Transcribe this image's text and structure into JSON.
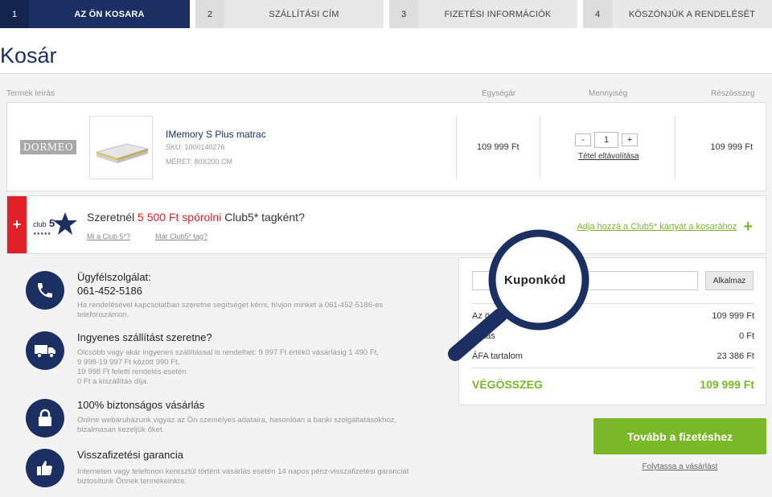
{
  "steps": [
    {
      "num": "1",
      "label": "AZ ÖN KOSARA"
    },
    {
      "num": "2",
      "label": "SZÁLLÍTÁSI CÍM"
    },
    {
      "num": "3",
      "label": "FIZETÉSI INFORMÁCIÓK"
    },
    {
      "num": "4",
      "label": "KÖSZÖNJÜK A RENDELÉSÉT"
    }
  ],
  "page_title": "Kosár",
  "columns": {
    "product": "Termék leírás",
    "unit_price": "Egységár",
    "quantity": "Mennyiség",
    "subtotal": "Részösszeg"
  },
  "item": {
    "brand": "DORMEO",
    "name": "IMemory S Plus matrac",
    "sku": "SKU: 1000140276",
    "size": "MÉRET:  80X200 CM",
    "unit_price": "109 999 Ft",
    "qty_minus": "-",
    "qty": "1",
    "qty_plus": "+",
    "remove": "Tétel eltávolítása",
    "subtotal": "109 999 Ft"
  },
  "club": {
    "plus": "+",
    "logo_text": "club",
    "logo_num": "5",
    "q_prefix": "Szeretnél ",
    "q_highlight": "5 500 Ft spórolni",
    "q_suffix": " Club5* tagként?",
    "link_what": "Mi a Club 5*?",
    "link_member": "Már Club5* tag?",
    "add_link": "Adja hozzá a Club5* kártyát a kosarához",
    "add_plus": "+"
  },
  "info": [
    {
      "heading": "Ügyfélszolgálat:",
      "phone": "061-452-5186",
      "text": [
        "Ha rendelésével kapcsolatban szeretne segítséget kérni, hívjon minket a 061-452-5186-es",
        "telefonszámon."
      ],
      "icon": "phone-icon"
    },
    {
      "heading": "Ingyenes szállítást szeretne?",
      "text": [
        "Olcsóbb vagy akár ingyenes szállítással is rendelhet: 9 997 Ft értékű vásárlásig 1 490 Ft,",
        "9 998-19 997 Ft között 990 Ft,",
        "19 998 Ft feletti rendelés esetén",
        "0 Ft a kiszállítás díja."
      ],
      "icon": "truck-icon"
    },
    {
      "heading": "100% biztonságos vásárlás",
      "text": [
        "Online webáruházunk vigyáz az Ön személyes adataira, hasonlóan a banki szolgáltatásokhoz,",
        "bizalmasan kezeljük őket."
      ],
      "icon": "lock-icon"
    },
    {
      "heading": "Visszafizetési garancia",
      "text": [
        "Interneten vagy telefonon keresztül történt vásárlás esetén 14 napos pénz-visszafizetési garanciát",
        "biztosítunk Önnek termékeinkre."
      ],
      "icon": "thumbs-up-icon"
    }
  ],
  "summary": {
    "coupon_label": "Kuponkód",
    "apply": "Alkalmaz",
    "rows": [
      {
        "label": "Az ö",
        "value": "109 999 Ft"
      },
      {
        "label": "állítás",
        "value": "0 Ft"
      },
      {
        "label": "ÁFA tartalom",
        "value": "23 386 Ft"
      }
    ],
    "total_label": "VÉGÖSSZEG",
    "total_value": "109 999 Ft"
  },
  "checkout": "Tovább a fizetéshez",
  "continue": "Folytassa a vásárlást",
  "colors": {
    "navy": "#1c2f63",
    "green": "#7ab829",
    "red": "#e0202b"
  }
}
